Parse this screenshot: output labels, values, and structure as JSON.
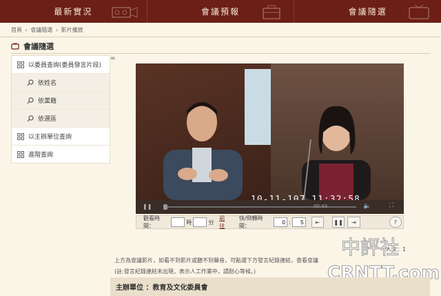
{
  "topnav": {
    "tabs": [
      {
        "label": "最新實況"
      },
      {
        "label": "會議預報"
      },
      {
        "label": "會議隨選"
      }
    ]
  },
  "breadcrumb": [
    "首頁",
    "›",
    "會議隨選",
    "›",
    "影片播放"
  ],
  "section": {
    "title": "會議隨選"
  },
  "sidebar": {
    "items": [
      {
        "label": "以委員查詢(委員發言片段)",
        "sub": false
      },
      {
        "label": "依姓名",
        "sub": true
      },
      {
        "label": "依黨籍",
        "sub": true
      },
      {
        "label": "依選區",
        "sub": true
      },
      {
        "label": "以主辦單位查詢",
        "sub": false
      },
      {
        "label": "進階查詢",
        "sub": false
      }
    ]
  },
  "video": {
    "timestamp": "10-11-107  11:32:58",
    "time_counter": "00:43"
  },
  "controls": {
    "watch_time_label": "觀看時間：",
    "hour_unit": "時",
    "minute_unit": "分",
    "goto_link": "前往",
    "seek_label": "快/倒轉時間：",
    "seek_value": "0",
    "seek_step": "5"
  },
  "description": "上方為會議影片，如看不到影片或聽不到聲音，可點選下方發言紀錄連結，查看會議",
  "note": "(註:發言紀錄連結未出現，表示人工作業中，請耐心等候。)",
  "views": {
    "label": "人次：1"
  },
  "host": {
    "label": "主辦單位 ：教育及文化委員會"
  },
  "watermark": {
    "line1": "中評社",
    "line2": "CRNTT.com"
  },
  "colors": {
    "nav": "#6b1f16",
    "bg": "#fbf5e8",
    "accent": "#eadfca"
  }
}
